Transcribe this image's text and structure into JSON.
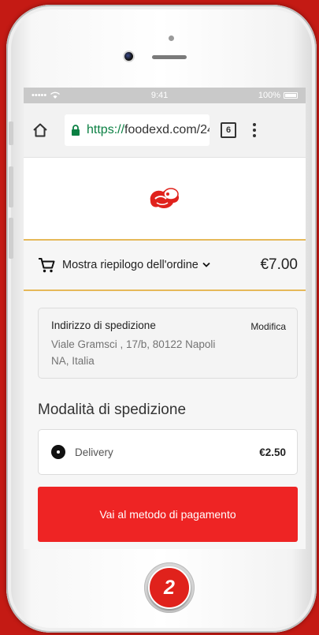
{
  "statusbar": {
    "carrier": "•••••",
    "time": "9:41",
    "battery": "100%"
  },
  "browser": {
    "url_scheme": "https://",
    "url_rest": "foodexd.com/24",
    "tab_count": "6",
    "icons": [
      "home-icon",
      "lock-icon",
      "tabs-icon",
      "menu-icon"
    ]
  },
  "order_summary": {
    "label": "Mostra riepilogo dell'ordine",
    "total": "€7.00"
  },
  "address": {
    "title": "Indirizzo di spedizione",
    "edit_label": "Modifica",
    "line1": "Viale Gramsci , 17/b, 80122 Napoli",
    "line2": "NA, Italia"
  },
  "shipping": {
    "section_title": "Modalità di spedizione",
    "method_name": "Delivery",
    "method_price": "€2.50"
  },
  "cta": {
    "label": "Vai al metodo di pagamento"
  },
  "step_badge": "2",
  "colors": {
    "accent_red": "#ee2424",
    "divider_gold": "#e6b95a",
    "url_green": "#0b8043"
  }
}
